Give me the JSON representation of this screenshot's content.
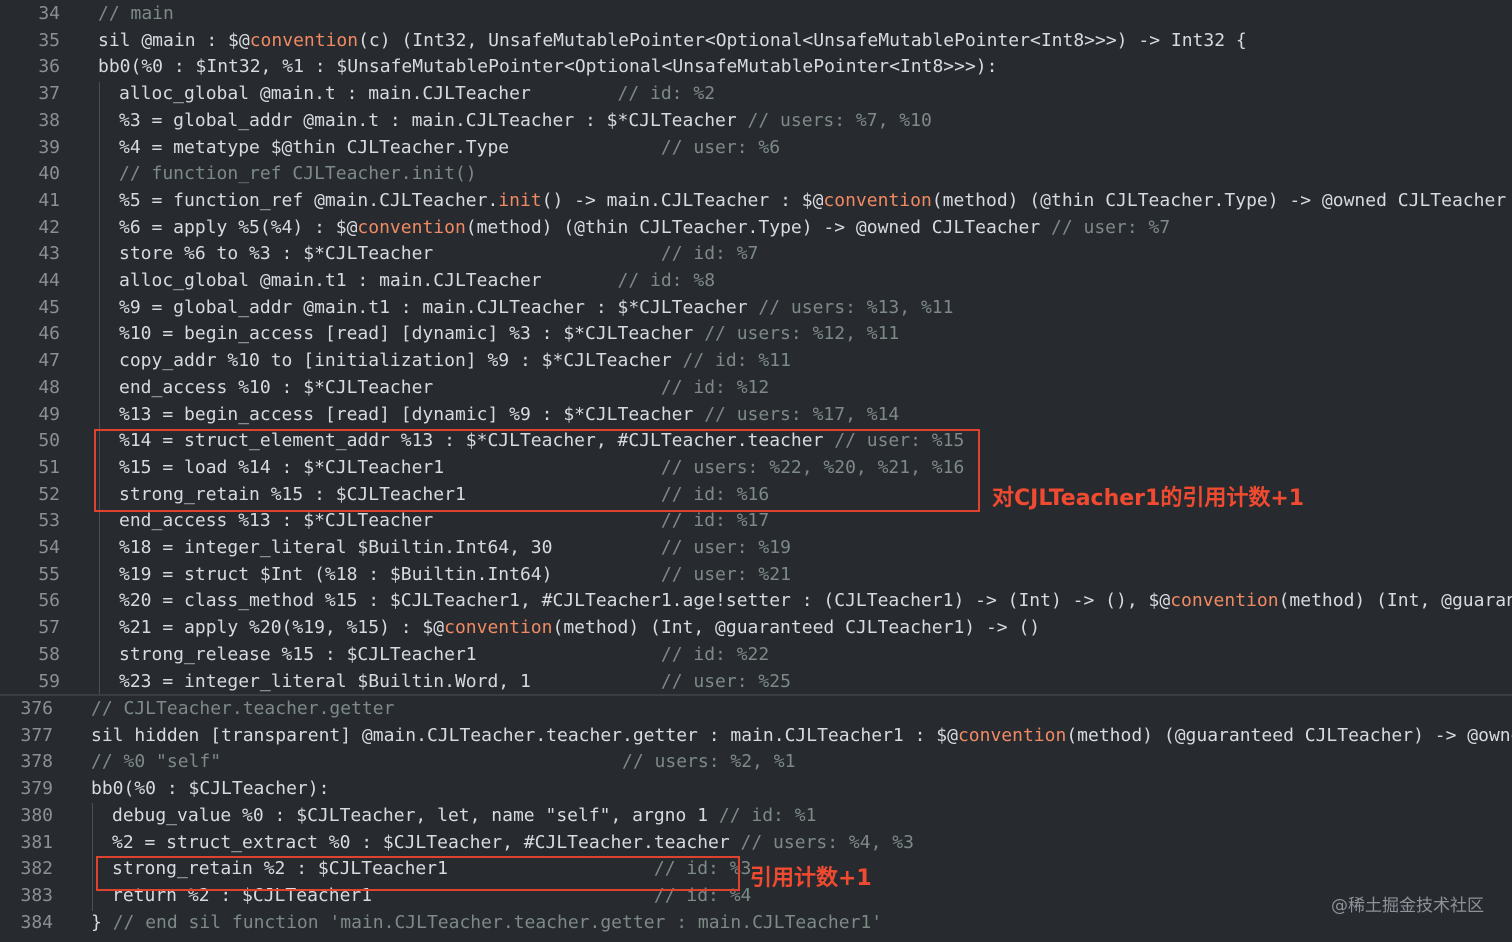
{
  "top_lines": [
    {
      "n": "34",
      "text": "// main",
      "cls": "c-com"
    },
    {
      "n": "35",
      "parts": [
        [
          "sil @main : $@",
          ""
        ],
        [
          "convention",
          "c-key"
        ],
        [
          "(c) (Int32, UnsafeMutablePointer<Optional<UnsafeMutablePointer<Int8>>>) -> Int32 {",
          ""
        ]
      ]
    },
    {
      "n": "36",
      "text": "bb0(%0 : $Int32, %1 : $UnsafeMutablePointer<Optional<UnsafeMutablePointer<Int8>>>):"
    },
    {
      "n": "37",
      "indent": true,
      "parts": [
        [
          "alloc_global @main.t : main.CJLTeacher        ",
          ""
        ],
        [
          "// id: %2",
          "c-com"
        ]
      ]
    },
    {
      "n": "38",
      "indent": true,
      "parts": [
        [
          "%3 = global_addr @main.t : main.CJLTeacher : $*CJLTeacher ",
          ""
        ],
        [
          "// users: %7, %10",
          "c-com"
        ]
      ]
    },
    {
      "n": "39",
      "indent": true,
      "parts": [
        [
          "%4 = metatype $@thin CJLTeacher.Type              ",
          ""
        ],
        [
          "// user: %6",
          "c-com"
        ]
      ]
    },
    {
      "n": "40",
      "indent": true,
      "parts": [
        [
          "// function_ref CJLTeacher.init()",
          "c-com"
        ]
      ]
    },
    {
      "n": "41",
      "indent": true,
      "parts": [
        [
          "%5 = function_ref @main.CJLTeacher.",
          ""
        ],
        [
          "init",
          "c-key"
        ],
        [
          "() -> main.CJLTeacher : $@",
          ""
        ],
        [
          "convention",
          "c-key"
        ],
        [
          "(method) (@thin CJLTeacher.Type) -> @owned CJLTeacher /",
          ""
        ]
      ]
    },
    {
      "n": "42",
      "indent": true,
      "parts": [
        [
          "%6 = apply %5(%4) : $@",
          ""
        ],
        [
          "convention",
          "c-key"
        ],
        [
          "(method) (@thin CJLTeacher.Type) -> @owned CJLTeacher ",
          ""
        ],
        [
          "// user: %7",
          "c-com"
        ]
      ]
    },
    {
      "n": "43",
      "indent": true,
      "parts": [
        [
          "store %6 to %3 : $*CJLTeacher                     ",
          ""
        ],
        [
          "// id: %7",
          "c-com"
        ]
      ]
    },
    {
      "n": "44",
      "indent": true,
      "parts": [
        [
          "alloc_global @main.t1 : main.CJLTeacher       ",
          ""
        ],
        [
          "// id: %8",
          "c-com"
        ]
      ]
    },
    {
      "n": "45",
      "indent": true,
      "parts": [
        [
          "%9 = global_addr @main.t1 : main.CJLTeacher : $*CJLTeacher ",
          ""
        ],
        [
          "// users: %13, %11",
          "c-com"
        ]
      ]
    },
    {
      "n": "46",
      "indent": true,
      "parts": [
        [
          "%10 = begin_access [read] [dynamic] %3 : $*CJLTeacher ",
          ""
        ],
        [
          "// users: %12, %11",
          "c-com"
        ]
      ]
    },
    {
      "n": "47",
      "indent": true,
      "parts": [
        [
          "copy_addr %10 to [initialization] %9 : $*CJLTeacher ",
          ""
        ],
        [
          "// id: %11",
          "c-com"
        ]
      ]
    },
    {
      "n": "48",
      "indent": true,
      "parts": [
        [
          "end_access %10 : $*CJLTeacher                     ",
          ""
        ],
        [
          "// id: %12",
          "c-com"
        ]
      ]
    },
    {
      "n": "49",
      "indent": true,
      "parts": [
        [
          "%13 = begin_access [read] [dynamic] %9 : $*CJLTeacher ",
          ""
        ],
        [
          "// users: %17, %14",
          "c-com"
        ]
      ]
    },
    {
      "n": "50",
      "indent": true,
      "parts": [
        [
          "%14 = struct_element_addr %13 : $*CJLTeacher, #CJLTeacher.teacher ",
          ""
        ],
        [
          "// user: %15",
          "c-com"
        ]
      ]
    },
    {
      "n": "51",
      "indent": true,
      "parts": [
        [
          "%15 = load %14 : $*CJLTeacher1                    ",
          ""
        ],
        [
          "// users: %22, %20, %21, %16",
          "c-com"
        ]
      ]
    },
    {
      "n": "52",
      "indent": true,
      "parts": [
        [
          "strong_retain %15 : $CJLTeacher1                  ",
          ""
        ],
        [
          "// id: %16",
          "c-com"
        ]
      ]
    },
    {
      "n": "53",
      "indent": true,
      "parts": [
        [
          "end_access %13 : $*CJLTeacher                     ",
          ""
        ],
        [
          "// id: %17",
          "c-com"
        ]
      ]
    },
    {
      "n": "54",
      "indent": true,
      "parts": [
        [
          "%18 = integer_literal $Builtin.Int64, 30          ",
          ""
        ],
        [
          "// user: %19",
          "c-com"
        ]
      ]
    },
    {
      "n": "55",
      "indent": true,
      "parts": [
        [
          "%19 = struct $Int (%18 : $Builtin.Int64)          ",
          ""
        ],
        [
          "// user: %21",
          "c-com"
        ]
      ]
    },
    {
      "n": "56",
      "indent": true,
      "parts": [
        [
          "%20 = class_method %15 : $CJLTeacher1, #CJLTeacher1.age!setter : (CJLTeacher1) -> (Int) -> (), $@",
          ""
        ],
        [
          "convention",
          "c-key"
        ],
        [
          "(method) (Int, @guarante",
          ""
        ]
      ]
    },
    {
      "n": "57",
      "indent": true,
      "parts": [
        [
          "%21 = apply %20(%19, %15) : $@",
          ""
        ],
        [
          "convention",
          "c-key"
        ],
        [
          "(method) (Int, @guaranteed CJLTeacher1) -> ()",
          ""
        ]
      ]
    },
    {
      "n": "58",
      "indent": true,
      "parts": [
        [
          "strong_release %15 : $CJLTeacher1                 ",
          ""
        ],
        [
          "// id: %22",
          "c-com"
        ]
      ]
    },
    {
      "n": "59",
      "indent": true,
      "parts": [
        [
          "%23 = integer_literal $Builtin.Word, 1            ",
          ""
        ],
        [
          "// user: %25",
          "c-com"
        ]
      ]
    }
  ],
  "bottom_lines": [
    {
      "n": "376",
      "parts": [
        [
          "// CJLTeacher.teacher.getter",
          "c-com"
        ]
      ]
    },
    {
      "n": "377",
      "parts": [
        [
          "sil hidden [transparent] @main.CJLTeacher.teacher.getter : main.CJLTeacher1 : $@",
          ""
        ],
        [
          "convention",
          "c-key"
        ],
        [
          "(method) (@guaranteed CJLTeacher) -> @owned",
          ""
        ]
      ]
    },
    {
      "n": "378",
      "parts": [
        [
          "// %0 \"self\"                                     // users: %2, %1",
          "c-com"
        ]
      ]
    },
    {
      "n": "379",
      "parts": [
        [
          "bb0(%0 : $CJLTeacher):",
          ""
        ]
      ]
    },
    {
      "n": "380",
      "indent": true,
      "parts": [
        [
          "debug_value %0 : $CJLTeacher, let, name \"self\", argno 1 ",
          ""
        ],
        [
          "// id: %1",
          "c-com"
        ]
      ]
    },
    {
      "n": "381",
      "indent": true,
      "parts": [
        [
          "%2 = struct_extract %0 : $CJLTeacher, #CJLTeacher.teacher ",
          ""
        ],
        [
          "// users: %4, %3",
          "c-com"
        ]
      ]
    },
    {
      "n": "382",
      "indent": true,
      "parts": [
        [
          "strong_retain %2 : $CJLTeacher1                   ",
          ""
        ],
        [
          "// id: %3",
          "c-com"
        ]
      ]
    },
    {
      "n": "383",
      "indent": true,
      "parts": [
        [
          "return %2 : $CJLTeacher1                          ",
          ""
        ],
        [
          "// id: %4",
          "c-com"
        ]
      ]
    },
    {
      "n": "384",
      "parts": [
        [
          "} ",
          ""
        ],
        [
          "// end sil function 'main.CJLTeacher.teacher.getter : main.CJLTeacher1'",
          "c-com"
        ]
      ]
    }
  ],
  "annotations": {
    "note_top": "对CJLTeacher1的引用计数+1",
    "note_bottom": "引用计数+1"
  },
  "watermark": "@稀土掘金技术社区",
  "colors": {
    "background": "#272a2f",
    "highlight_box": "#e0432d",
    "annotation_text": "#f04a30",
    "keyword_orange": "#f08a63",
    "comment": "#7d8a86"
  }
}
